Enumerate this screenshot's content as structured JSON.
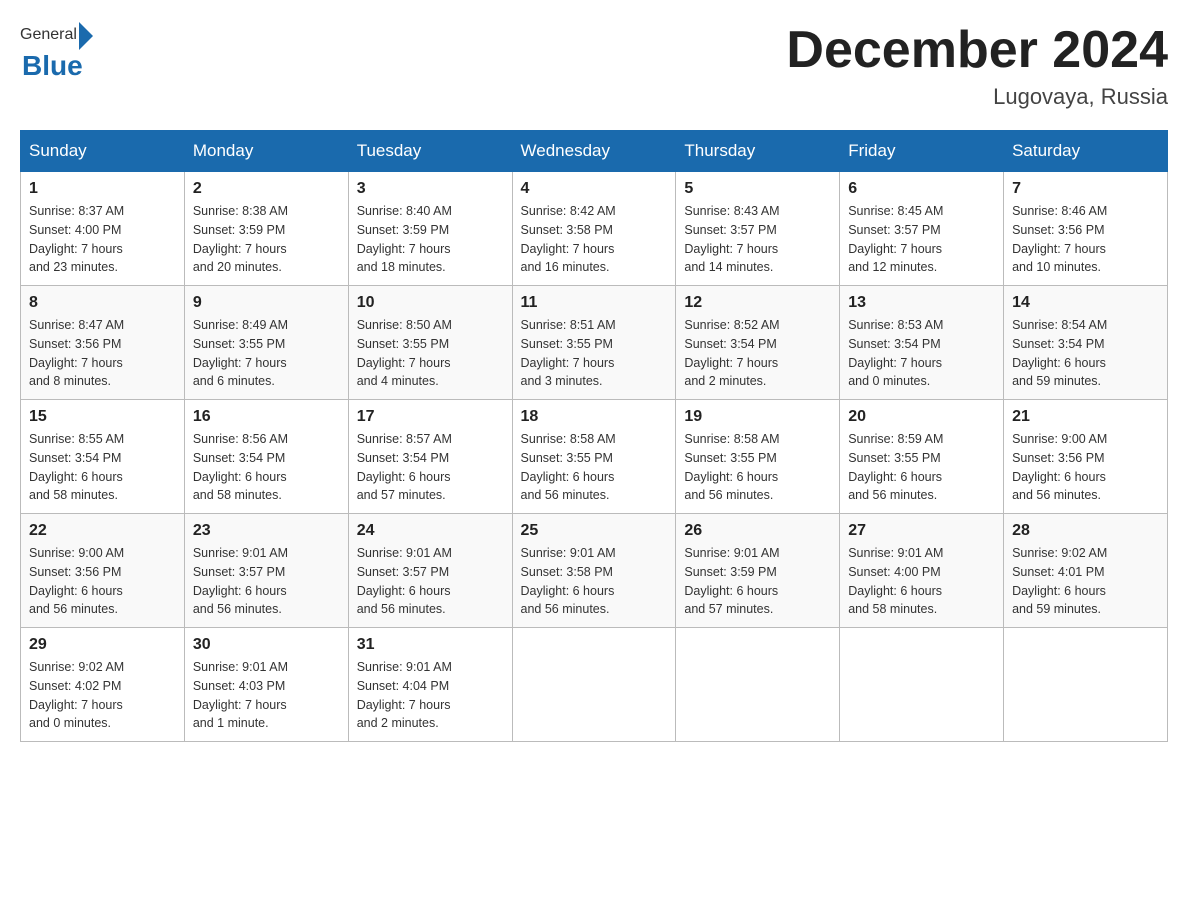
{
  "header": {
    "logo_general": "General",
    "logo_blue": "Blue",
    "title": "December 2024",
    "subtitle": "Lugovaya, Russia"
  },
  "weekdays": [
    "Sunday",
    "Monday",
    "Tuesday",
    "Wednesday",
    "Thursday",
    "Friday",
    "Saturday"
  ],
  "weeks": [
    [
      {
        "day": "1",
        "sunrise": "Sunrise: 8:37 AM",
        "sunset": "Sunset: 4:00 PM",
        "daylight": "Daylight: 7 hours",
        "minutes": "and 23 minutes."
      },
      {
        "day": "2",
        "sunrise": "Sunrise: 8:38 AM",
        "sunset": "Sunset: 3:59 PM",
        "daylight": "Daylight: 7 hours",
        "minutes": "and 20 minutes."
      },
      {
        "day": "3",
        "sunrise": "Sunrise: 8:40 AM",
        "sunset": "Sunset: 3:59 PM",
        "daylight": "Daylight: 7 hours",
        "minutes": "and 18 minutes."
      },
      {
        "day": "4",
        "sunrise": "Sunrise: 8:42 AM",
        "sunset": "Sunset: 3:58 PM",
        "daylight": "Daylight: 7 hours",
        "minutes": "and 16 minutes."
      },
      {
        "day": "5",
        "sunrise": "Sunrise: 8:43 AM",
        "sunset": "Sunset: 3:57 PM",
        "daylight": "Daylight: 7 hours",
        "minutes": "and 14 minutes."
      },
      {
        "day": "6",
        "sunrise": "Sunrise: 8:45 AM",
        "sunset": "Sunset: 3:57 PM",
        "daylight": "Daylight: 7 hours",
        "minutes": "and 12 minutes."
      },
      {
        "day": "7",
        "sunrise": "Sunrise: 8:46 AM",
        "sunset": "Sunset: 3:56 PM",
        "daylight": "Daylight: 7 hours",
        "minutes": "and 10 minutes."
      }
    ],
    [
      {
        "day": "8",
        "sunrise": "Sunrise: 8:47 AM",
        "sunset": "Sunset: 3:56 PM",
        "daylight": "Daylight: 7 hours",
        "minutes": "and 8 minutes."
      },
      {
        "day": "9",
        "sunrise": "Sunrise: 8:49 AM",
        "sunset": "Sunset: 3:55 PM",
        "daylight": "Daylight: 7 hours",
        "minutes": "and 6 minutes."
      },
      {
        "day": "10",
        "sunrise": "Sunrise: 8:50 AM",
        "sunset": "Sunset: 3:55 PM",
        "daylight": "Daylight: 7 hours",
        "minutes": "and 4 minutes."
      },
      {
        "day": "11",
        "sunrise": "Sunrise: 8:51 AM",
        "sunset": "Sunset: 3:55 PM",
        "daylight": "Daylight: 7 hours",
        "minutes": "and 3 minutes."
      },
      {
        "day": "12",
        "sunrise": "Sunrise: 8:52 AM",
        "sunset": "Sunset: 3:54 PM",
        "daylight": "Daylight: 7 hours",
        "minutes": "and 2 minutes."
      },
      {
        "day": "13",
        "sunrise": "Sunrise: 8:53 AM",
        "sunset": "Sunset: 3:54 PM",
        "daylight": "Daylight: 7 hours",
        "minutes": "and 0 minutes."
      },
      {
        "day": "14",
        "sunrise": "Sunrise: 8:54 AM",
        "sunset": "Sunset: 3:54 PM",
        "daylight": "Daylight: 6 hours",
        "minutes": "and 59 minutes."
      }
    ],
    [
      {
        "day": "15",
        "sunrise": "Sunrise: 8:55 AM",
        "sunset": "Sunset: 3:54 PM",
        "daylight": "Daylight: 6 hours",
        "minutes": "and 58 minutes."
      },
      {
        "day": "16",
        "sunrise": "Sunrise: 8:56 AM",
        "sunset": "Sunset: 3:54 PM",
        "daylight": "Daylight: 6 hours",
        "minutes": "and 58 minutes."
      },
      {
        "day": "17",
        "sunrise": "Sunrise: 8:57 AM",
        "sunset": "Sunset: 3:54 PM",
        "daylight": "Daylight: 6 hours",
        "minutes": "and 57 minutes."
      },
      {
        "day": "18",
        "sunrise": "Sunrise: 8:58 AM",
        "sunset": "Sunset: 3:55 PM",
        "daylight": "Daylight: 6 hours",
        "minutes": "and 56 minutes."
      },
      {
        "day": "19",
        "sunrise": "Sunrise: 8:58 AM",
        "sunset": "Sunset: 3:55 PM",
        "daylight": "Daylight: 6 hours",
        "minutes": "and 56 minutes."
      },
      {
        "day": "20",
        "sunrise": "Sunrise: 8:59 AM",
        "sunset": "Sunset: 3:55 PM",
        "daylight": "Daylight: 6 hours",
        "minutes": "and 56 minutes."
      },
      {
        "day": "21",
        "sunrise": "Sunrise: 9:00 AM",
        "sunset": "Sunset: 3:56 PM",
        "daylight": "Daylight: 6 hours",
        "minutes": "and 56 minutes."
      }
    ],
    [
      {
        "day": "22",
        "sunrise": "Sunrise: 9:00 AM",
        "sunset": "Sunset: 3:56 PM",
        "daylight": "Daylight: 6 hours",
        "minutes": "and 56 minutes."
      },
      {
        "day": "23",
        "sunrise": "Sunrise: 9:01 AM",
        "sunset": "Sunset: 3:57 PM",
        "daylight": "Daylight: 6 hours",
        "minutes": "and 56 minutes."
      },
      {
        "day": "24",
        "sunrise": "Sunrise: 9:01 AM",
        "sunset": "Sunset: 3:57 PM",
        "daylight": "Daylight: 6 hours",
        "minutes": "and 56 minutes."
      },
      {
        "day": "25",
        "sunrise": "Sunrise: 9:01 AM",
        "sunset": "Sunset: 3:58 PM",
        "daylight": "Daylight: 6 hours",
        "minutes": "and 56 minutes."
      },
      {
        "day": "26",
        "sunrise": "Sunrise: 9:01 AM",
        "sunset": "Sunset: 3:59 PM",
        "daylight": "Daylight: 6 hours",
        "minutes": "and 57 minutes."
      },
      {
        "day": "27",
        "sunrise": "Sunrise: 9:01 AM",
        "sunset": "Sunset: 4:00 PM",
        "daylight": "Daylight: 6 hours",
        "minutes": "and 58 minutes."
      },
      {
        "day": "28",
        "sunrise": "Sunrise: 9:02 AM",
        "sunset": "Sunset: 4:01 PM",
        "daylight": "Daylight: 6 hours",
        "minutes": "and 59 minutes."
      }
    ],
    [
      {
        "day": "29",
        "sunrise": "Sunrise: 9:02 AM",
        "sunset": "Sunset: 4:02 PM",
        "daylight": "Daylight: 7 hours",
        "minutes": "and 0 minutes."
      },
      {
        "day": "30",
        "sunrise": "Sunrise: 9:01 AM",
        "sunset": "Sunset: 4:03 PM",
        "daylight": "Daylight: 7 hours",
        "minutes": "and 1 minute."
      },
      {
        "day": "31",
        "sunrise": "Sunrise: 9:01 AM",
        "sunset": "Sunset: 4:04 PM",
        "daylight": "Daylight: 7 hours",
        "minutes": "and 2 minutes."
      },
      null,
      null,
      null,
      null
    ]
  ]
}
